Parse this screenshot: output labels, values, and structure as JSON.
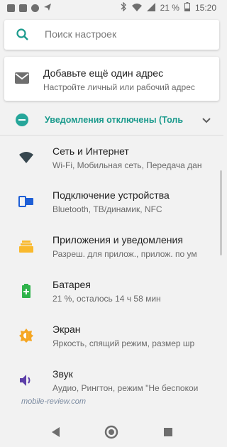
{
  "status": {
    "battery": "21 %",
    "time": "15:20"
  },
  "search": {
    "placeholder": "Поиск настроек"
  },
  "suggestion": {
    "title": "Добавьте ещё один адрес",
    "subtitle": "Настройте личный или рабочий адрес"
  },
  "condition": {
    "label": "Уведомления отключены (Толь"
  },
  "settings": [
    {
      "title": "Сеть и Интернет",
      "subtitle": "Wi-Fi, Мобильная сеть, Передача дан",
      "icon": "wifi-icon",
      "color": "#37474f"
    },
    {
      "title": "Подключение устройства",
      "subtitle": "Bluetooth, ТВ/динамик, NFC",
      "icon": "devices-icon",
      "color": "#1e5fd6"
    },
    {
      "title": "Приложения и уведомления",
      "subtitle": "Разреш. для прилож., прилож. по ум",
      "icon": "apps-icon",
      "color": "#f9b92d"
    },
    {
      "title": "Батарея",
      "subtitle": "21 %, осталось 14 ч 58 мин",
      "icon": "battery-icon",
      "color": "#2fb34b"
    },
    {
      "title": "Экран",
      "subtitle": "Яркость, спящий режим, размер шр",
      "icon": "brightness-icon",
      "color": "#f5a623"
    },
    {
      "title": "Звук",
      "subtitle": "Аудио, Рингтон, режим \"Не беспокои",
      "icon": "volume-icon",
      "color": "#5c3ea8"
    }
  ],
  "watermark": "mobile-review.com"
}
